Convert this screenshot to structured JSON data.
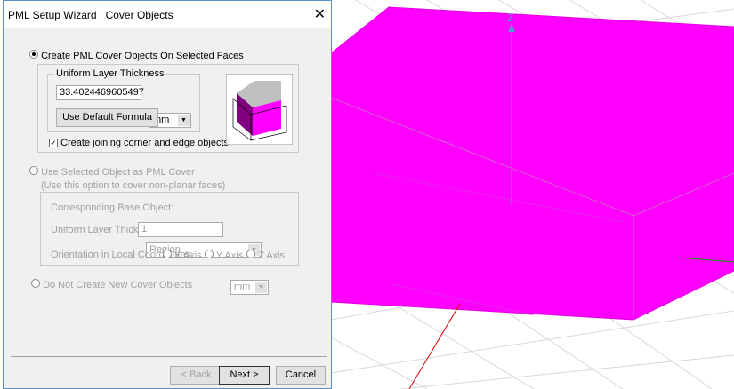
{
  "dialog": {
    "title": "PML Setup Wizard : Cover Objects",
    "option1": "Create PML Cover Objects On Selected Faces",
    "group_label": "Uniform Layer Thickness",
    "thickness_value": "33.4024469605497",
    "thickness_unit": "mm",
    "default_formula_button": "Use Default Formula",
    "joining_checkbox": "Create joining corner and edge objects",
    "option2": "Use Selected Object as PML Cover",
    "option2_hint": "(Use this option to cover non-planar faces)",
    "base_object_label": "Corresponding Base Object:",
    "base_object_value": "Region",
    "layer_thickness_label": "Uniform Layer Thickness:",
    "layer_thickness_value": "1",
    "layer_thickness_unit": "mm",
    "orientation_label": "Orientation in Local Coordinates:",
    "axes": [
      "X Axis",
      "Y Axis",
      "Z Axis"
    ],
    "option3": "Do Not Create New Cover Objects",
    "back_button": "< Back",
    "next_button": "Next >",
    "cancel_button": "Cancel"
  },
  "viewport": {
    "axis_label": "Z",
    "box_color": "#ff00ff"
  }
}
